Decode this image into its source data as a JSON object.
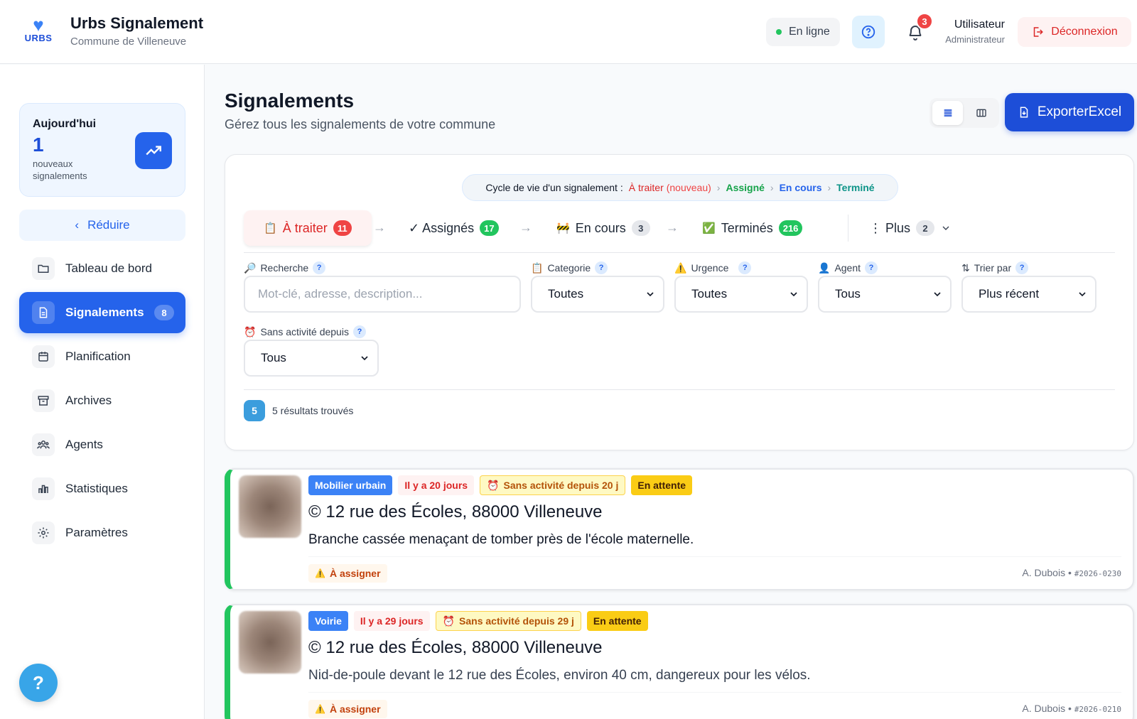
{
  "header": {
    "logo_text": "URBS",
    "title": "Urbs Signalement",
    "subtitle": "Commune de Villeneuve",
    "status": "En ligne",
    "notifications_count": "3",
    "user_name": "Utilisateur",
    "user_role": "Administrateur",
    "logout_label": "Déconnexion"
  },
  "sidebar": {
    "today_label": "Aujourd'hui",
    "today_count": "1",
    "today_desc": "nouveaux signalements",
    "reduce_label": "Réduire",
    "items": [
      {
        "label": "Tableau de bord",
        "icon": "folder-icon"
      },
      {
        "label": "Signalements",
        "icon": "document-icon",
        "badge": "8",
        "active": true
      },
      {
        "label": "Planification",
        "icon": "calendar-icon"
      },
      {
        "label": "Archives",
        "icon": "archive-icon"
      },
      {
        "label": "Agents",
        "icon": "users-icon"
      },
      {
        "label": "Statistiques",
        "icon": "bar-chart-icon"
      },
      {
        "label": "Paramètres",
        "icon": "gear-icon"
      }
    ],
    "help_label": "?"
  },
  "main": {
    "title": "Signalements",
    "subtitle": "Gérez tous les signalements de votre commune",
    "export_label": "ExporterExcel",
    "lifecycle": {
      "prefix": "Cycle de vie d'un signalement :",
      "step1": "À traiter",
      "step1_note": "(nouveau)",
      "step2": "Assigné",
      "step3": "En cours",
      "step4": "Terminé"
    },
    "tabs": [
      {
        "label": "À traiter",
        "count": "11",
        "icon": "📋"
      },
      {
        "label": "✓ Assignés",
        "count": "17"
      },
      {
        "label": "En cours",
        "count": "3",
        "icon": "🚧"
      },
      {
        "label": "Terminés",
        "count": "216",
        "icon": "✅"
      },
      {
        "label": "⋮ Plus",
        "count": "2"
      }
    ],
    "filters": {
      "search_label": "Recherche",
      "search_placeholder": "Mot-clé, adresse, description...",
      "category_label": "Categorie",
      "category_value": "Toutes",
      "urgency_label": "Urgence",
      "urgency_value": "Toutes",
      "agent_label": "Agent",
      "agent_value": "Tous",
      "sort_label": "Trier par",
      "sort_value": "Plus récent",
      "inactivity_label": "Sans activité depuis",
      "inactivity_value": "Tous"
    },
    "results_count": "5",
    "results_text": "5 résultats trouvés"
  },
  "reports": [
    {
      "category": "Mobilier urbain",
      "age": "Il y a 20 jours",
      "inactivity": "Sans activité depuis 20 j",
      "status": "En attente",
      "address": "12 rue des Écoles, 88000 Villeneuve",
      "description": "Branche cassée menaçant de tomber près de l'école maternelle.",
      "assign": "À assigner",
      "agent": "A. Dubois •",
      "ref": "#2026-0230"
    },
    {
      "category": "Voirie",
      "age": "Il y a 29 jours",
      "inactivity": "Sans activité depuis 29 j",
      "status": "En attente",
      "address": "12 rue des Écoles, 88000 Villeneuve",
      "description": "Nid-de-poule devant le 12 rue des Écoles, environ 40 cm, dangereux pour les vélos.",
      "assign": "À assigner",
      "agent": "A. Dubois •",
      "ref": "#2026-0210"
    }
  ]
}
